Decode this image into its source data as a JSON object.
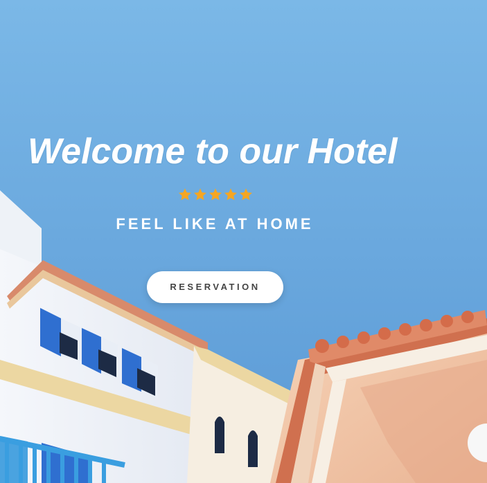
{
  "hero": {
    "title": "Welcome to our Hotel",
    "rating_stars": 5,
    "subtitle": "FEEL LIKE AT HOME",
    "button_label": "RESERVATION"
  },
  "colors": {
    "sky": "#6aacdf",
    "star": "#f5a623",
    "title_text": "#ffffff",
    "button_bg": "#ffffff",
    "button_text": "#444444",
    "building_white": "#f1f4f8",
    "trim_yellow": "#ecd7a2",
    "roof_tile": "#d88a6b",
    "shutter_blue": "#2f6fd0",
    "wall_peach": "#f2c7a7"
  },
  "icons": [
    "star-icon"
  ]
}
